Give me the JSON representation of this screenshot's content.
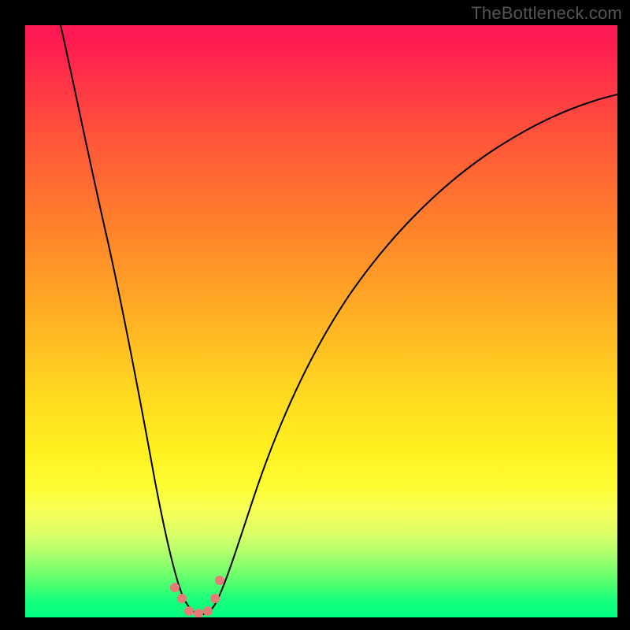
{
  "watermark": "TheBottleneck.com",
  "chart_data": {
    "type": "line",
    "title": "",
    "xlabel": "",
    "ylabel": "",
    "xlim": [
      0,
      100
    ],
    "ylim": [
      0,
      100
    ],
    "grid": false,
    "background": "vertical-gradient red-to-green",
    "series": [
      {
        "name": "bottleneck-curve",
        "x": [
          6,
          10,
          14,
          18,
          21,
          24,
          26.5,
          28,
          30,
          32.5,
          36,
          42,
          50,
          60,
          70,
          80,
          90,
          100
        ],
        "y": [
          100,
          85,
          68,
          50,
          33,
          15,
          3,
          0,
          0,
          3,
          13,
          30,
          46,
          60,
          70,
          77,
          82,
          85
        ]
      }
    ],
    "markers": {
      "name": "highlight-points",
      "color": "#e77b78",
      "points": [
        {
          "x": 25.3,
          "y": 5.0
        },
        {
          "x": 26.5,
          "y": 3.2
        },
        {
          "x": 27.6,
          "y": 1.0
        },
        {
          "x": 29.2,
          "y": 0.6
        },
        {
          "x": 30.8,
          "y": 1.0
        },
        {
          "x": 32.0,
          "y": 3.2
        },
        {
          "x": 32.8,
          "y": 6.2
        }
      ]
    }
  }
}
